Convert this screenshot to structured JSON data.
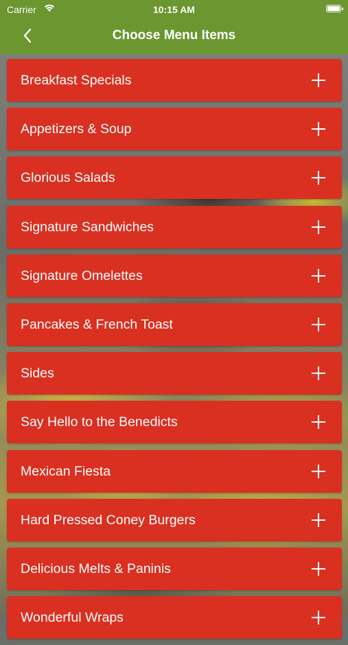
{
  "status_bar": {
    "carrier": "Carrier",
    "time": "10:15 AM"
  },
  "nav": {
    "title": "Choose Menu Items",
    "back_icon": "chevron-left-icon"
  },
  "colors": {
    "nav_background": "#6b9630",
    "item_background": "#d93021",
    "text": "#ffffff"
  },
  "menu": {
    "categories": [
      "Breakfast Specials",
      "Appetizers & Soup",
      "Glorious Salads",
      "Signature Sandwiches",
      "Signature Omelettes",
      "Pancakes & French Toast",
      "Sides",
      "Say Hello to the Benedicts",
      "Mexican Fiesta",
      "Hard Pressed Coney Burgers",
      "Delicious Melts & Paninis",
      "Wonderful Wraps"
    ],
    "expand_icon": "plus-icon"
  }
}
